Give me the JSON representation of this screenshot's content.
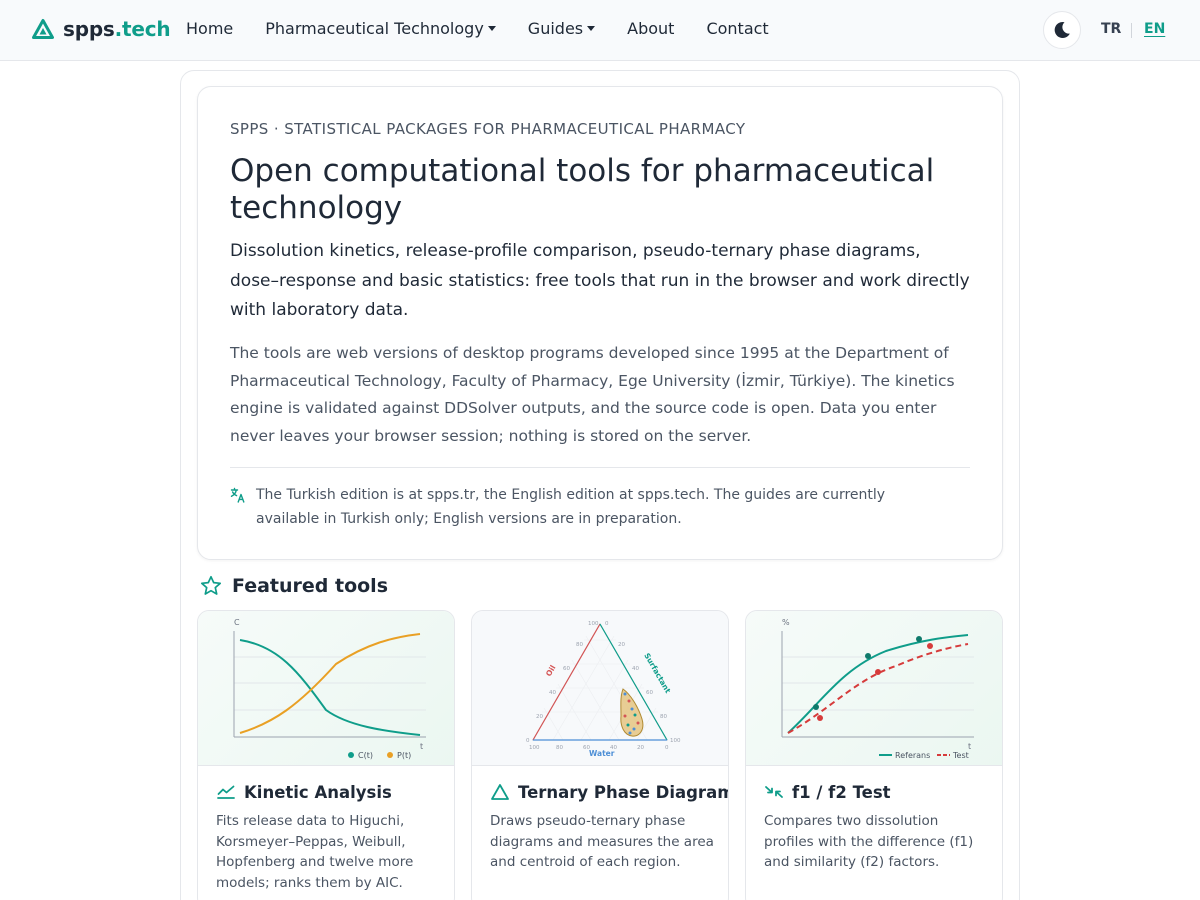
{
  "brand": {
    "name": "spps",
    "tld": ".tech"
  },
  "nav": {
    "items": [
      {
        "label": "Home",
        "dropdown": false
      },
      {
        "label": "Pharmaceutical Technology",
        "dropdown": true
      },
      {
        "label": "Guides",
        "dropdown": true
      },
      {
        "label": "About",
        "dropdown": false
      },
      {
        "label": "Contact",
        "dropdown": false
      }
    ],
    "theme_icon": "moon-icon",
    "lang_tr": "TR",
    "lang_en": "EN",
    "active_lang": "EN"
  },
  "hero": {
    "eyebrow": "SPPS · STATISTICAL PACKAGES FOR PHARMACEUTICAL PHARMACY",
    "title": "Open computational tools for pharmaceutical technology",
    "lead": "Dissolution kinetics, release-profile comparison, pseudo-ternary phase diagrams, dose–response and basic statistics: free tools that run in the browser and work directly with laboratory data.",
    "body": "The tools are web versions of desktop programs developed since 1995 at the Department of Pharmaceutical Technology, Faculty of Pharmacy, Ege University (İzmir, Türkiye). The kinetics engine is validated against DDSolver outputs, and the source code is open. Data you enter never leaves your browser session; nothing is stored on the server.",
    "note": "The Turkish edition is at spps.tr, the English edition at spps.tech. The guides are currently available in Turkish only; English versions are in preparation."
  },
  "featured": {
    "title": "Featured tools",
    "cards": [
      {
        "title": "Kinetic Analysis",
        "desc": "Fits release data to Higuchi, Korsmeyer–Peppas, Weibull, Hopfenberg and twelve more models; ranks them by AIC.",
        "icon": "chart-line-icon",
        "axis_y": "C",
        "axis_x": "t",
        "legend": [
          "C(t)",
          "P(t)"
        ]
      },
      {
        "title": "Ternary Phase Diagram",
        "desc": "Draws pseudo-ternary phase diagrams and measures the area and centroid of each region.",
        "icon": "triangle-icon",
        "labels": {
          "left": "Oil",
          "right": "Surfactant",
          "bottom": "Water"
        },
        "ticks": {
          "left": [
            "100",
            "80",
            "60",
            "40",
            "20",
            "0"
          ],
          "right": [
            "0",
            "20",
            "40",
            "60",
            "80",
            "100"
          ],
          "bottom": [
            "100",
            "80",
            "60",
            "40",
            "20",
            "0"
          ]
        }
      },
      {
        "title": "f1 / f2 Test",
        "desc": "Compares two dissolution profiles with the difference (f1) and similarity (f2) factors.",
        "icon": "compare-arrows-icon",
        "axis_y": "%",
        "axis_x": "t",
        "legend": [
          "Referans",
          "Test"
        ]
      }
    ]
  },
  "colors": {
    "accent": "#0f9d8a",
    "orange": "#e9a024",
    "red": "#d63b3b",
    "text": "#1f2937",
    "muted": "#4b5563"
  }
}
